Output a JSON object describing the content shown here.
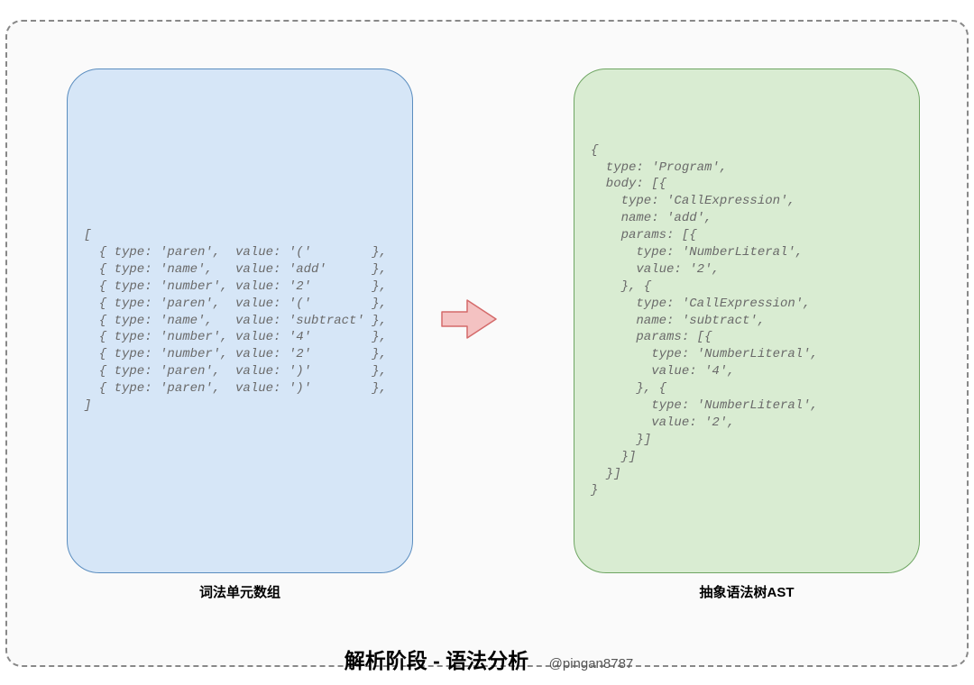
{
  "labels": {
    "left": "词法单元数组",
    "right": "抽象语法树AST"
  },
  "title": {
    "main": "解析阶段 - 语法分析",
    "author": "@pingan8787"
  },
  "code": {
    "left": "[\n  { type: 'paren',  value: '('        },\n  { type: 'name',   value: 'add'      },\n  { type: 'number', value: '2'        },\n  { type: 'paren',  value: '('        },\n  { type: 'name',   value: 'subtract' },\n  { type: 'number', value: '4'        },\n  { type: 'number', value: '2'        },\n  { type: 'paren',  value: ')'        },\n  { type: 'paren',  value: ')'        },\n]",
    "right": "{\n  type: 'Program',\n  body: [{\n    type: 'CallExpression',\n    name: 'add',\n    params: [{\n      type: 'NumberLiteral',\n      value: '2',\n    }, {\n      type: 'CallExpression',\n      name: 'subtract',\n      params: [{\n        type: 'NumberLiteral',\n        value: '4',\n      }, {\n        type: 'NumberLiteral',\n        value: '2',\n      }]\n    }]\n  }]\n}"
  },
  "tokens": [
    {
      "type": "paren",
      "value": "("
    },
    {
      "type": "name",
      "value": "add"
    },
    {
      "type": "number",
      "value": "2"
    },
    {
      "type": "paren",
      "value": "("
    },
    {
      "type": "name",
      "value": "subtract"
    },
    {
      "type": "number",
      "value": "4"
    },
    {
      "type": "number",
      "value": "2"
    },
    {
      "type": "paren",
      "value": ")"
    },
    {
      "type": "paren",
      "value": ")"
    }
  ],
  "ast": {
    "type": "Program",
    "body": [
      {
        "type": "CallExpression",
        "name": "add",
        "params": [
          {
            "type": "NumberLiteral",
            "value": "2"
          },
          {
            "type": "CallExpression",
            "name": "subtract",
            "params": [
              {
                "type": "NumberLiteral",
                "value": "4"
              },
              {
                "type": "NumberLiteral",
                "value": "2"
              }
            ]
          }
        ]
      }
    ]
  },
  "colors": {
    "left_fill": "#d6e6f7",
    "left_stroke": "#5a8dbf",
    "right_fill": "#d9ecd2",
    "right_stroke": "#6ea562",
    "arrow_fill": "#f4c2c2",
    "arrow_stroke": "#d46a6a"
  }
}
